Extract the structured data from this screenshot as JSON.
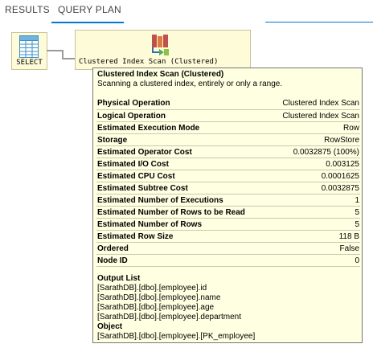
{
  "tabs": [
    {
      "label": "RESULTS"
    },
    {
      "label": "QUERY PLAN"
    }
  ],
  "accent_color": "#0078d4",
  "plan": {
    "select_node": {
      "label": "SELECT",
      "icon": "select-table-icon"
    },
    "scan_node": {
      "label": "Clustered Index Scan (Clustered)",
      "icon": "clustered-index-scan-icon"
    }
  },
  "tooltip": {
    "title": "Clustered Index Scan (Clustered)",
    "description": "Scanning a clustered index, entirely or only a range.",
    "properties": [
      {
        "key": "Physical Operation",
        "value": "Clustered Index Scan"
      },
      {
        "key": "Logical Operation",
        "value": "Clustered Index Scan"
      },
      {
        "key": "Estimated Execution Mode",
        "value": "Row"
      },
      {
        "key": "Storage",
        "value": "RowStore"
      },
      {
        "key": "Estimated Operator Cost",
        "value": "0.0032875 (100%)"
      },
      {
        "key": "Estimated I/O Cost",
        "value": "0.003125"
      },
      {
        "key": "Estimated CPU Cost",
        "value": "0.0001625"
      },
      {
        "key": "Estimated Subtree Cost",
        "value": "0.0032875"
      },
      {
        "key": "Estimated Number of Executions",
        "value": "1"
      },
      {
        "key": "Estimated Number of Rows to be Read",
        "value": "5"
      },
      {
        "key": "Estimated Number of Rows",
        "value": "5"
      },
      {
        "key": "Estimated Row Size",
        "value": "118 B"
      },
      {
        "key": "Ordered",
        "value": "False"
      },
      {
        "key": "Node ID",
        "value": "0"
      }
    ],
    "output_list_title": "Output List",
    "output_list": [
      "[SarathDB].[dbo].[employee].id",
      "[SarathDB].[dbo].[employee].name",
      "[SarathDB].[dbo].[employee].age",
      "[SarathDB].[dbo].[employee].department"
    ],
    "object_title": "Object",
    "object": "[SarathDB].[dbo].[employee].[PK_employee]"
  }
}
